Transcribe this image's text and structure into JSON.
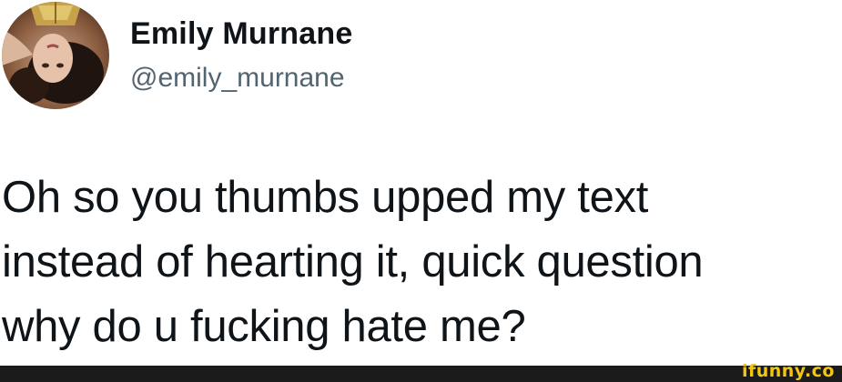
{
  "author": {
    "display_name": "Emily Murnane",
    "handle": "@emily_murnane"
  },
  "tweet": {
    "lines": [
      "Oh so you thumbs upped my text",
      "instead of hearting it, quick question",
      "why do u fucking hate me?"
    ]
  },
  "watermark": {
    "text": "ifunny.co"
  },
  "colors": {
    "text": "#0f1419",
    "handle": "#536471",
    "footer_bar": "#1b1b1b",
    "watermark": "#f3c614"
  }
}
